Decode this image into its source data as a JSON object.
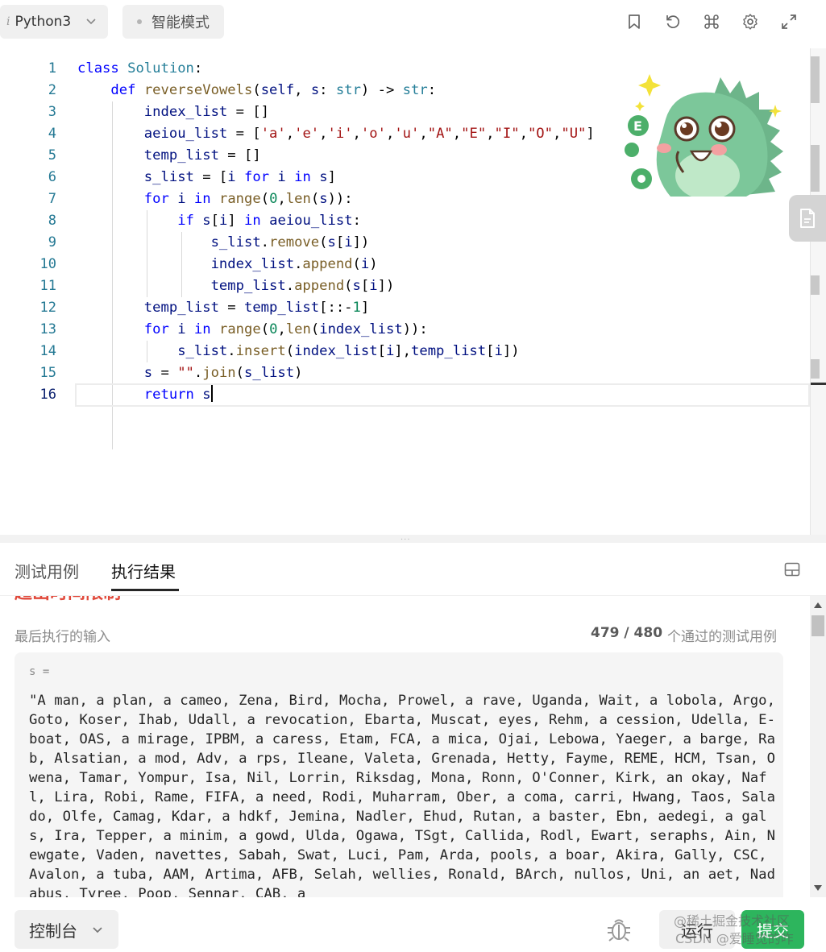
{
  "toolbar": {
    "language_prefix": "i",
    "language": "Python3",
    "mode": "智能模式",
    "icons": [
      "bookmark-icon",
      "reset-icon",
      "command-icon",
      "settings-icon",
      "fullscreen-icon"
    ]
  },
  "editor": {
    "line_numbers": [
      "1",
      "2",
      "3",
      "4",
      "5",
      "6",
      "7",
      "8",
      "9",
      "10",
      "11",
      "12",
      "13",
      "14",
      "15",
      "16"
    ],
    "active_line": 16
  },
  "bottom_panel": {
    "tabs": [
      {
        "label": "测试用例",
        "active": false
      },
      {
        "label": "执行结果",
        "active": true
      }
    ],
    "status_peek": "超出时间限制",
    "last_input_label": "最后执行的输入",
    "passed_count": "479 / 480",
    "passed_label": "个通过的测试用例",
    "variable_label": "s =",
    "input_value": "\"A man, a plan, a cameo, Zena, Bird, Mocha, Prowel, a rave, Uganda, Wait, a lobola, Argo, Goto, Koser, Ihab, Udall, a revocation, Ebarta, Muscat, eyes, Rehm, a cession, Udella, E-boat, OAS, a mirage, IPBM, a caress, Etam, FCA, a mica, Ojai, Lebowa, Yaeger, a barge, Rab, Alsatian, a mod, Adv, a rps, Ileane, Valeta, Grenada, Hetty, Fayme, REME, HCM, Tsan, Owena, Tamar, Yompur, Isa, Nil, Lorrin, Riksdag, Mona, Ronn, O'Conner, Kirk, an okay, Nafl, Lira, Robi, Rame, FIFA, a need, Rodi, Muharram, Ober, a coma, carri, Hwang, Taos, Salado, Olfe, Camag, Kdar, a hdkf, Jemina, Nadler, Ehud, Rutan, a baster, Ebn, aedegi, a gals, Ira, Tepper, a minim, a gowd, Ulda, Ogawa, TSgt, Callida, Rodl, Ewart, seraphs, Ain, Newgate, Vaden, navettes, Sabah, Swat, Luci, Pam, Arda, pools, a boar, Akira, Gally, CSC, Avalon, a tuba, AAM, Artima, AFB, Selah, wellies, Ronald, BArch, nullos, Uni, an aet, Nadabus, Tyree, Poop, Sennar, CAB, a"
  },
  "footer": {
    "console_label": "控制台",
    "run_label": "运行",
    "submit_label": "提交",
    "watermark_line1": "@稀土掘金技术社区",
    "watermark_line2": "CSDN @爱睡觉的咋"
  },
  "colors": {
    "keyword": "#0000ff",
    "type": "#267f99",
    "function": "#795e26",
    "string": "#a31515",
    "number": "#098658",
    "line_number": "#237893",
    "submit_green": "#2db55d",
    "error_red": "#e0493b"
  }
}
